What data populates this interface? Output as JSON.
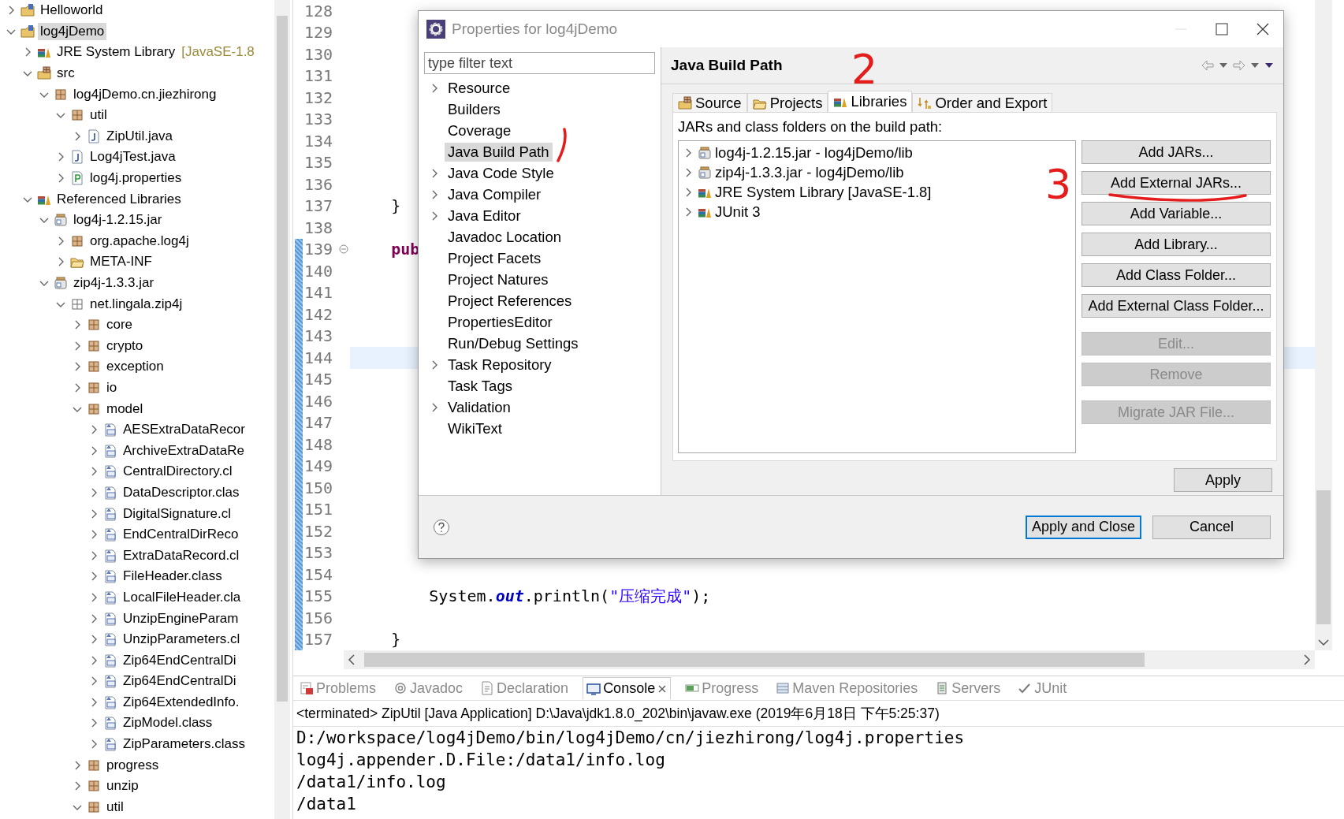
{
  "explorer": {
    "items": [
      {
        "label": "Helloworld",
        "kind": "project",
        "expanded": false,
        "selected": false
      },
      {
        "label": "log4jDemo",
        "kind": "project",
        "expanded": true,
        "selected": true,
        "children": [
          {
            "label": "JRE System Library",
            "decoration": "[JavaSE-1.8",
            "kind": "library",
            "expanded": false,
            "selected": false
          },
          {
            "label": "src",
            "kind": "srcfolder",
            "expanded": true,
            "selected": false,
            "children": [
              {
                "label": "log4jDemo.cn.jiezhirong",
                "kind": "package",
                "expanded": true,
                "selected": false,
                "children": [
                  {
                    "label": "util",
                    "kind": "package",
                    "expanded": true,
                    "selected": false,
                    "children": [
                      {
                        "label": "ZipUtil.java",
                        "kind": "java",
                        "expanded": false,
                        "selected": false
                      }
                    ]
                  },
                  {
                    "label": "Log4jTest.java",
                    "kind": "java",
                    "expanded": false,
                    "selected": false
                  },
                  {
                    "label": "log4j.properties",
                    "kind": "props",
                    "expanded": false,
                    "selected": false
                  }
                ]
              }
            ]
          },
          {
            "label": "Referenced Libraries",
            "kind": "library",
            "expanded": true,
            "selected": false,
            "children": [
              {
                "label": "log4j-1.2.15.jar",
                "kind": "jar",
                "expanded": true,
                "selected": false,
                "children": [
                  {
                    "label": "org.apache.log4j",
                    "kind": "package",
                    "expanded": false,
                    "selected": false
                  },
                  {
                    "label": "META-INF",
                    "kind": "folder",
                    "expanded": false,
                    "selected": false
                  }
                ]
              },
              {
                "label": "zip4j-1.3.3.jar",
                "kind": "jar",
                "expanded": true,
                "selected": false,
                "children": [
                  {
                    "label": "net.lingala.zip4j",
                    "kind": "package_plain",
                    "expanded": true,
                    "selected": false,
                    "children": [
                      {
                        "label": "core",
                        "kind": "package",
                        "expanded": false,
                        "selected": false
                      },
                      {
                        "label": "crypto",
                        "kind": "package",
                        "expanded": false,
                        "selected": false
                      },
                      {
                        "label": "exception",
                        "kind": "package",
                        "expanded": false,
                        "selected": false
                      },
                      {
                        "label": "io",
                        "kind": "package",
                        "expanded": false,
                        "selected": false
                      },
                      {
                        "label": "model",
                        "kind": "package",
                        "expanded": true,
                        "selected": false,
                        "children": [
                          {
                            "label": "AESExtraDataRecor",
                            "kind": "class",
                            "expanded": false,
                            "selected": false
                          },
                          {
                            "label": "ArchiveExtraDataRe",
                            "kind": "class",
                            "expanded": false,
                            "selected": false
                          },
                          {
                            "label": "CentralDirectory.cl",
                            "kind": "class",
                            "expanded": false,
                            "selected": false
                          },
                          {
                            "label": "DataDescriptor.clas",
                            "kind": "class",
                            "expanded": false,
                            "selected": false
                          },
                          {
                            "label": "DigitalSignature.cl",
                            "kind": "class",
                            "expanded": false,
                            "selected": false
                          },
                          {
                            "label": "EndCentralDirReco",
                            "kind": "class",
                            "expanded": false,
                            "selected": false
                          },
                          {
                            "label": "ExtraDataRecord.cl",
                            "kind": "class",
                            "expanded": false,
                            "selected": false
                          },
                          {
                            "label": "FileHeader.class",
                            "kind": "class",
                            "expanded": false,
                            "selected": false
                          },
                          {
                            "label": "LocalFileHeader.cla",
                            "kind": "class",
                            "expanded": false,
                            "selected": false
                          },
                          {
                            "label": "UnzipEngineParam",
                            "kind": "class",
                            "expanded": false,
                            "selected": false
                          },
                          {
                            "label": "UnzipParameters.cl",
                            "kind": "class",
                            "expanded": false,
                            "selected": false
                          },
                          {
                            "label": "Zip64EndCentralDi",
                            "kind": "class",
                            "expanded": false,
                            "selected": false
                          },
                          {
                            "label": "Zip64EndCentralDi",
                            "kind": "class",
                            "expanded": false,
                            "selected": false
                          },
                          {
                            "label": "Zip64ExtendedInfo.",
                            "kind": "class",
                            "expanded": false,
                            "selected": false
                          },
                          {
                            "label": "ZipModel.class",
                            "kind": "class",
                            "expanded": false,
                            "selected": false
                          },
                          {
                            "label": "ZipParameters.class",
                            "kind": "class",
                            "expanded": false,
                            "selected": false
                          }
                        ]
                      },
                      {
                        "label": "progress",
                        "kind": "package",
                        "expanded": false,
                        "selected": false
                      },
                      {
                        "label": "unzip",
                        "kind": "package",
                        "expanded": false,
                        "selected": false
                      },
                      {
                        "label": "util",
                        "kind": "package",
                        "expanded": true,
                        "selected": false
                      }
                    ]
                  }
                ]
              }
            ]
          }
        ]
      }
    ]
  },
  "editor": {
    "lines": [
      {
        "number": "128",
        "current": false,
        "changed": false,
        "foldable": false
      },
      {
        "number": "129",
        "current": false,
        "changed": false,
        "foldable": false
      },
      {
        "number": "130",
        "current": false,
        "changed": false,
        "foldable": false
      },
      {
        "number": "131",
        "current": false,
        "changed": false,
        "foldable": false
      },
      {
        "number": "132",
        "current": false,
        "changed": false,
        "foldable": false
      },
      {
        "number": "133",
        "current": false,
        "changed": false,
        "foldable": false
      },
      {
        "number": "134",
        "current": false,
        "changed": false,
        "foldable": false
      },
      {
        "number": "135",
        "current": false,
        "changed": false,
        "foldable": false
      },
      {
        "number": "136",
        "current": false,
        "changed": false,
        "foldable": false
      },
      {
        "number": "137",
        "current": false,
        "changed": false,
        "foldable": false,
        "segments": [
          {
            "text": "    }",
            "kind": "plain"
          }
        ]
      },
      {
        "number": "138",
        "current": false,
        "changed": false,
        "foldable": false
      },
      {
        "number": "139",
        "current": false,
        "changed": true,
        "foldable": true,
        "segments": [
          {
            "text": "    pub",
            "kind": "keyword"
          }
        ]
      },
      {
        "number": "140",
        "current": false,
        "changed": true,
        "foldable": false
      },
      {
        "number": "141",
        "current": false,
        "changed": true,
        "foldable": false
      },
      {
        "number": "142",
        "current": false,
        "changed": true,
        "foldable": false
      },
      {
        "number": "143",
        "current": false,
        "changed": true,
        "foldable": false
      },
      {
        "number": "144",
        "current": true,
        "changed": true,
        "foldable": false
      },
      {
        "number": "145",
        "current": false,
        "changed": true,
        "foldable": false
      },
      {
        "number": "146",
        "current": false,
        "changed": true,
        "foldable": false
      },
      {
        "number": "147",
        "current": false,
        "changed": true,
        "foldable": false
      },
      {
        "number": "148",
        "current": false,
        "changed": true,
        "foldable": false
      },
      {
        "number": "149",
        "current": false,
        "changed": true,
        "foldable": false
      },
      {
        "number": "150",
        "current": false,
        "changed": true,
        "foldable": false
      },
      {
        "number": "151",
        "current": false,
        "changed": true,
        "foldable": false
      },
      {
        "number": "152",
        "current": false,
        "changed": true,
        "foldable": false
      },
      {
        "number": "153",
        "current": false,
        "changed": true,
        "foldable": false
      },
      {
        "number": "154",
        "current": false,
        "changed": true,
        "foldable": false
      },
      {
        "number": "155",
        "current": false,
        "changed": true,
        "foldable": false,
        "segments": [
          {
            "text": "        System.",
            "kind": "plain"
          },
          {
            "text": "out",
            "kind": "field"
          },
          {
            "text": ".println(",
            "kind": "plain"
          },
          {
            "text": "\"压缩完成\"",
            "kind": "string"
          },
          {
            "text": ");",
            "kind": "plain"
          }
        ]
      },
      {
        "number": "156",
        "current": false,
        "changed": true,
        "foldable": false
      },
      {
        "number": "157",
        "current": false,
        "changed": true,
        "foldable": false,
        "segments": [
          {
            "text": "    }",
            "kind": "plain"
          }
        ]
      }
    ]
  },
  "views": {
    "tabs": [
      {
        "label": "Problems",
        "kind": "problems",
        "selected": false
      },
      {
        "label": "Javadoc",
        "kind": "javadoc",
        "selected": false
      },
      {
        "label": "Declaration",
        "kind": "declaration",
        "selected": false
      },
      {
        "label": "Console",
        "kind": "console",
        "selected": true
      },
      {
        "label": "Progress",
        "kind": "progress",
        "selected": false
      },
      {
        "label": "Maven Repositories",
        "kind": "maven",
        "selected": false
      },
      {
        "label": "Servers",
        "kind": "servers",
        "selected": false
      },
      {
        "label": "JUnit",
        "kind": "junit",
        "selected": false
      }
    ],
    "console": {
      "header": "<terminated> ZipUtil [Java Application] D:\\Java\\jdk1.8.0_202\\bin\\javaw.exe (2019年6月18日 下午5:25:37)",
      "lines": [
        "D:/workspace/log4jDemo/bin/log4jDemo/cn/jiezhirong/log4j.properties",
        "log4j.appender.D.File:/data1/info.log",
        "/data1/info.log",
        "/data1"
      ]
    }
  },
  "dialog": {
    "title": "Properties for log4jDemo",
    "filter": {
      "placeholder": "type filter text"
    },
    "pages": [
      {
        "label": "Resource",
        "expandable": true,
        "selected": false
      },
      {
        "label": "Builders",
        "expandable": false,
        "selected": false
      },
      {
        "label": "Coverage",
        "expandable": false,
        "selected": false
      },
      {
        "label": "Java Build Path",
        "expandable": false,
        "selected": true
      },
      {
        "label": "Java Code Style",
        "expandable": true,
        "selected": false
      },
      {
        "label": "Java Compiler",
        "expandable": true,
        "selected": false
      },
      {
        "label": "Java Editor",
        "expandable": true,
        "selected": false
      },
      {
        "label": "Javadoc Location",
        "expandable": false,
        "selected": false
      },
      {
        "label": "Project Facets",
        "expandable": false,
        "selected": false
      },
      {
        "label": "Project Natures",
        "expandable": false,
        "selected": false
      },
      {
        "label": "Project References",
        "expandable": false,
        "selected": false
      },
      {
        "label": "PropertiesEditor",
        "expandable": false,
        "selected": false
      },
      {
        "label": "Run/Debug Settings",
        "expandable": false,
        "selected": false
      },
      {
        "label": "Task Repository",
        "expandable": true,
        "selected": false
      },
      {
        "label": "Task Tags",
        "expandable": false,
        "selected": false
      },
      {
        "label": "Validation",
        "expandable": true,
        "selected": false
      },
      {
        "label": "WikiText",
        "expandable": false,
        "selected": false
      }
    ],
    "page_title": "Java Build Path",
    "tabs": [
      {
        "label": "Source",
        "kind": "srcfolder",
        "selected": false
      },
      {
        "label": "Projects",
        "kind": "folder",
        "selected": false
      },
      {
        "label": "Libraries",
        "kind": "library",
        "selected": true
      },
      {
        "label": "Order and Export",
        "kind": "order",
        "selected": false
      }
    ],
    "list_label": "JARs and class folders on the build path:",
    "entries": [
      {
        "label": "log4j-1.2.15.jar - log4jDemo/lib",
        "kind": "jar",
        "expanded": false
      },
      {
        "label": "zip4j-1.3.3.jar - log4jDemo/lib",
        "kind": "jar",
        "expanded": false
      },
      {
        "label": "JRE System Library [JavaSE-1.8]",
        "kind": "library",
        "expanded": false
      },
      {
        "label": "JUnit 3",
        "kind": "library",
        "expanded": false
      }
    ],
    "button_groups": [
      {
        "buttons": [
          {
            "label": "Add JARs...",
            "disabled": false
          },
          {
            "label": "Add External JARs...",
            "disabled": false
          },
          {
            "label": "Add Variable...",
            "disabled": false
          },
          {
            "label": "Add Library...",
            "disabled": false
          },
          {
            "label": "Add Class Folder...",
            "disabled": false
          },
          {
            "label": "Add External Class Folder...",
            "disabled": false
          }
        ]
      },
      {
        "buttons": [
          {
            "label": "Edit...",
            "disabled": true
          },
          {
            "label": "Remove",
            "disabled": true
          }
        ]
      },
      {
        "buttons": [
          {
            "label": "Migrate JAR File...",
            "disabled": true
          }
        ]
      }
    ],
    "apply": "Apply",
    "footer_buttons": [
      {
        "label": "Apply and Close",
        "default": true
      },
      {
        "label": "Cancel",
        "default": false
      }
    ]
  },
  "annotations": [
    {
      "kind": "stroke"
    },
    {
      "kind": "number",
      "text": "2"
    },
    {
      "kind": "number",
      "text": "3"
    },
    {
      "kind": "underline"
    }
  ]
}
